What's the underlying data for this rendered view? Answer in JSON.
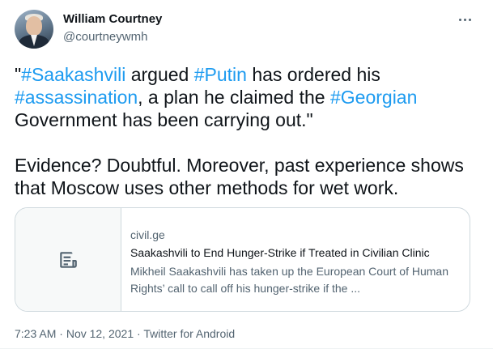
{
  "author": {
    "name": "William Courtney",
    "handle": "@courtneywmh"
  },
  "tweet": {
    "p1": [
      {
        "text": "\"",
        "tag": false
      },
      {
        "text": "#Saakashvili",
        "tag": true
      },
      {
        "text": " argued ",
        "tag": false
      },
      {
        "text": "#Putin",
        "tag": true
      },
      {
        "text": " has ordered his ",
        "tag": false
      },
      {
        "text": "#assassination",
        "tag": true
      },
      {
        "text": ", a plan he claimed the ",
        "tag": false
      },
      {
        "text": "#Georgian",
        "tag": true
      },
      {
        "text": " Government has been carrying out.\"",
        "tag": false
      }
    ],
    "p2": "Evidence?  Doubtful.  Moreover, past experience shows that Moscow uses other methods for wet work."
  },
  "card": {
    "domain": "civil.ge",
    "title": "Saakashvili to End Hunger-Strike if Treated in Civilian Clinic",
    "description": "Mikheil Saakashvili has taken up the European Court of Human Rights’ call to call off his hunger-strike if the ...",
    "icon": "article-icon"
  },
  "meta": {
    "time": "7:23 AM",
    "separator": " · ",
    "date": "Nov 12, 2021",
    "source": "Twitter for Android"
  },
  "colors": {
    "text": "#0f1419",
    "secondary": "#536471",
    "link": "#1d9bf0",
    "border": "#cfd9de"
  }
}
